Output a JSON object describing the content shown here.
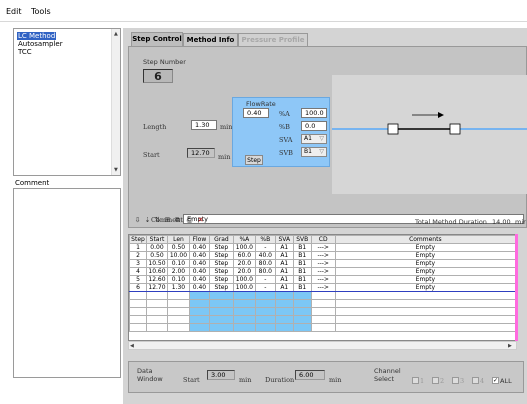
{
  "menu": {
    "items": [
      "Edit",
      "Tools"
    ]
  },
  "tree": {
    "items": [
      "LC Method",
      "Autosampler",
      "TCC"
    ],
    "selected_index": 0
  },
  "comment_panel": {
    "label": "Comment"
  },
  "tabs": [
    {
      "label": "Step Control",
      "state": "active"
    },
    {
      "label": "Method Info",
      "state": "normal"
    },
    {
      "label": "Pressure Profile",
      "state": "disabled"
    }
  ],
  "step_control": {
    "step_number_label": "Step Number",
    "step_number": "6",
    "length_label": "Length",
    "length_value": "1.30",
    "length_unit": "min",
    "start_label": "Start",
    "start_value": "12.70",
    "start_unit": "min",
    "flowrate_label": "FlowRate",
    "flowrate_value": "0.40",
    "pct_a_label": "%A",
    "pct_a_value": "100.0",
    "pct_b_label": "%B",
    "pct_b_value": "0.0",
    "sva_label": "SVA",
    "sva_value": "A1",
    "svb_label": "SVB",
    "svb_value": "B1",
    "step_button": "Step",
    "comment_label": "Comment",
    "comment_value": "Empty"
  },
  "colors": {
    "flow_panel": "#8ec7f7",
    "selection": "#3163c4",
    "flow_column": "#7cc7f5",
    "pink_marker": "#ff6adf"
  },
  "grid": {
    "total_duration_label": "Total Method Duration",
    "total_duration_value": "14.00",
    "total_duration_unit": "mir",
    "columns": [
      "Step",
      "Start",
      "Len",
      "Flow",
      "Grad",
      "%A",
      "%B",
      "SVA",
      "SVB",
      "CD",
      "Comments"
    ],
    "rows": [
      [
        "1",
        "0.00",
        "0.50",
        "0.40",
        "Step",
        "100.0",
        "-",
        "A1",
        "B1",
        "--->",
        "Empty"
      ],
      [
        "2",
        "0.50",
        "10.00",
        "0.40",
        "Step",
        "60.0",
        "40.0",
        "A1",
        "B1",
        "--->",
        "Empty"
      ],
      [
        "3",
        "10.50",
        "0.10",
        "0.40",
        "Step",
        "20.0",
        "80.0",
        "A1",
        "B1",
        "--->",
        "Empty"
      ],
      [
        "4",
        "10.60",
        "2.00",
        "0.40",
        "Step",
        "20.0",
        "80.0",
        "A1",
        "B1",
        "--->",
        "Empty"
      ],
      [
        "5",
        "12.60",
        "0.10",
        "0.40",
        "Step",
        "100.0",
        "-",
        "A1",
        "B1",
        "--->",
        "Empty"
      ],
      [
        "6",
        "12.70",
        "1.30",
        "0.40",
        "Step",
        "100.0",
        "-",
        "A1",
        "B1",
        "--->",
        "Empty"
      ]
    ],
    "selected_row": 5,
    "empty_rows": 5
  },
  "data_window": {
    "label_line1": "Data",
    "label_line2": "Window",
    "start_label": "Start",
    "start_value": "3.00",
    "start_unit": "min",
    "duration_label": "Duration",
    "duration_value": "6.00",
    "duration_unit": "min",
    "channel_label_line1": "Channel",
    "channel_label_line2": "Select",
    "channels": [
      "1",
      "2",
      "3",
      "4"
    ],
    "all_label": "ALL"
  }
}
